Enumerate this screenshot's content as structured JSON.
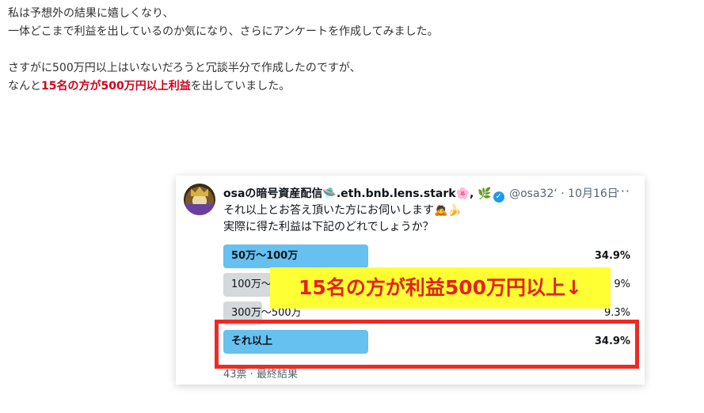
{
  "intro": {
    "line1": "私は予想外の結果に嬉しくなり、",
    "line2": "一体どこまで利益を出しているのか気になり、さらにアンケートを作成してみました。",
    "line3": "さすがに500万円以上はいないだろうと冗談半分で作成したのですが、",
    "line4_pre": "なんと",
    "line4_highlight": "15名の方が500万円以上利益",
    "line4_post": "を出していました。"
  },
  "tweet": {
    "display_name": "osaの暗号資産配信",
    "name_suffix": ".eth.bnb.lens.stark",
    "name_emoji_1": "🛸",
    "name_emoji_2": "🌸",
    "name_emoji_3": "🌿",
    "verified_icon": "✓",
    "handle": "@osa32‘",
    "separator": " · ",
    "date": "10月16日",
    "more_icon": "···",
    "line1": "それ以上とお答え頂いた方にお伺いします",
    "line1_emoji": "🙇🍌",
    "line2": "実際に得た利益は下記のどれでしょうか？",
    "poll": {
      "options": [
        {
          "label": "50万〜100万",
          "percent": "34.9%",
          "fill": 0.349,
          "winner": true
        },
        {
          "label": "100万〜",
          "percent": "9%",
          "fill": 0.209,
          "winner": false
        },
        {
          "label": "300万〜500万",
          "percent": "9.3%",
          "fill": 0.093,
          "winner": false
        },
        {
          "label": "それ以上",
          "percent": "34.9%",
          "fill": 0.349,
          "winner": true
        }
      ],
      "footer": "43票 · 最終結果"
    }
  },
  "overlay": {
    "text": "15名の方が利益500万円以上↓",
    "background_color": "#ffff33",
    "text_color": "#e3231c",
    "box_color": "#ee2a24"
  }
}
